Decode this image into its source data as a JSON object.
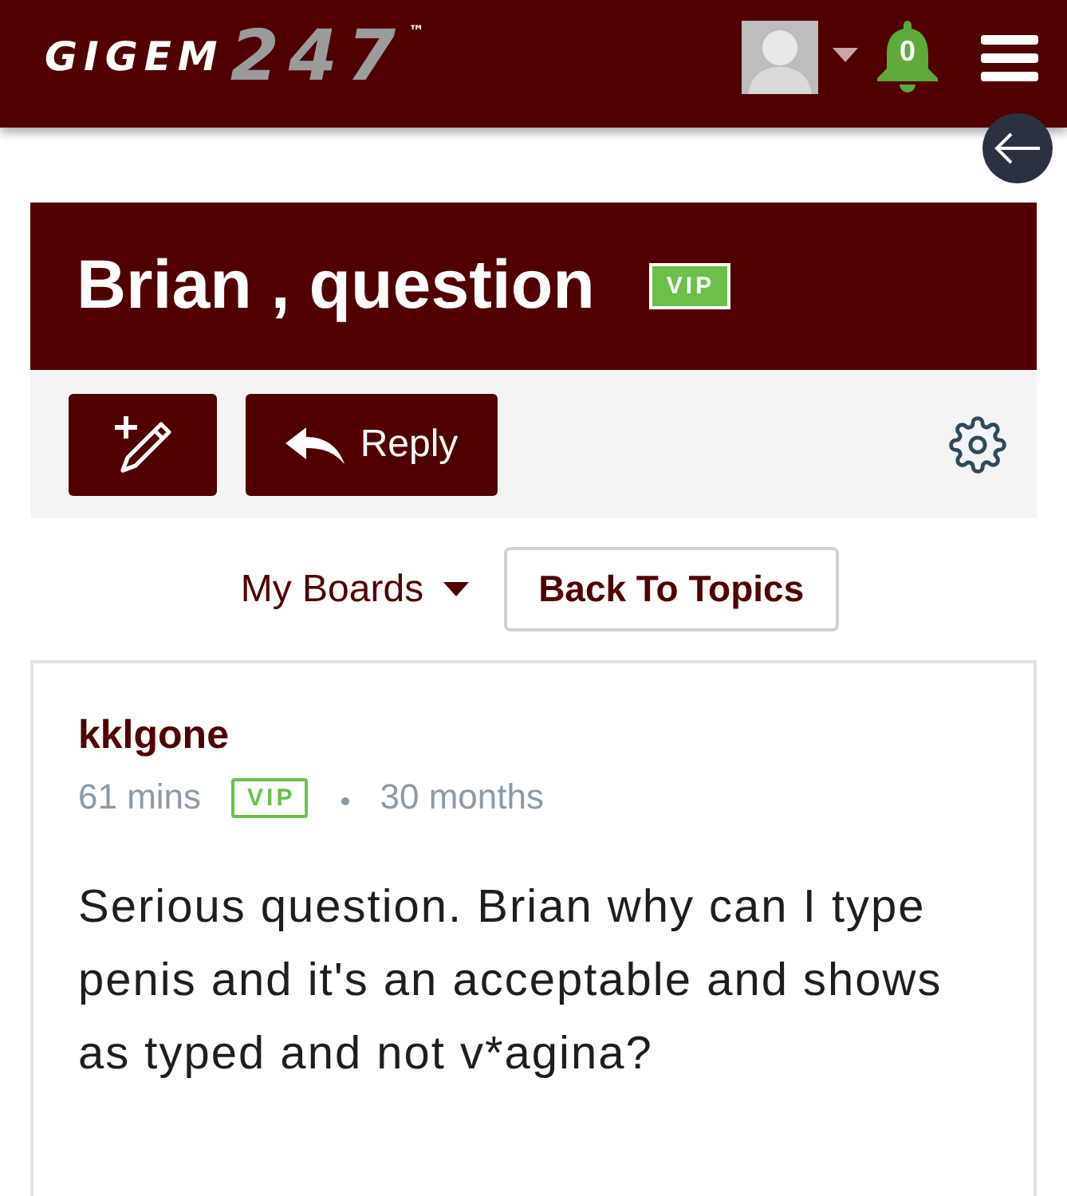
{
  "header": {
    "logo": {
      "word": "GIGEM",
      "number": "247",
      "trademark": "™"
    },
    "notifications": {
      "count": "0"
    }
  },
  "topic": {
    "title": "Brian , question",
    "badge": "VIP"
  },
  "toolbar": {
    "reply_button": "Reply"
  },
  "nav": {
    "boards_menu": "My Boards",
    "back_button": "Back To Topics"
  },
  "posts": [
    {
      "author": "kklgone",
      "time": "61 mins",
      "badge": "VIP",
      "tenure": "30 months",
      "body": "Serious question. Brian why can I type penis and it's an acceptable and shows as typed and not v*agina?"
    }
  ]
}
